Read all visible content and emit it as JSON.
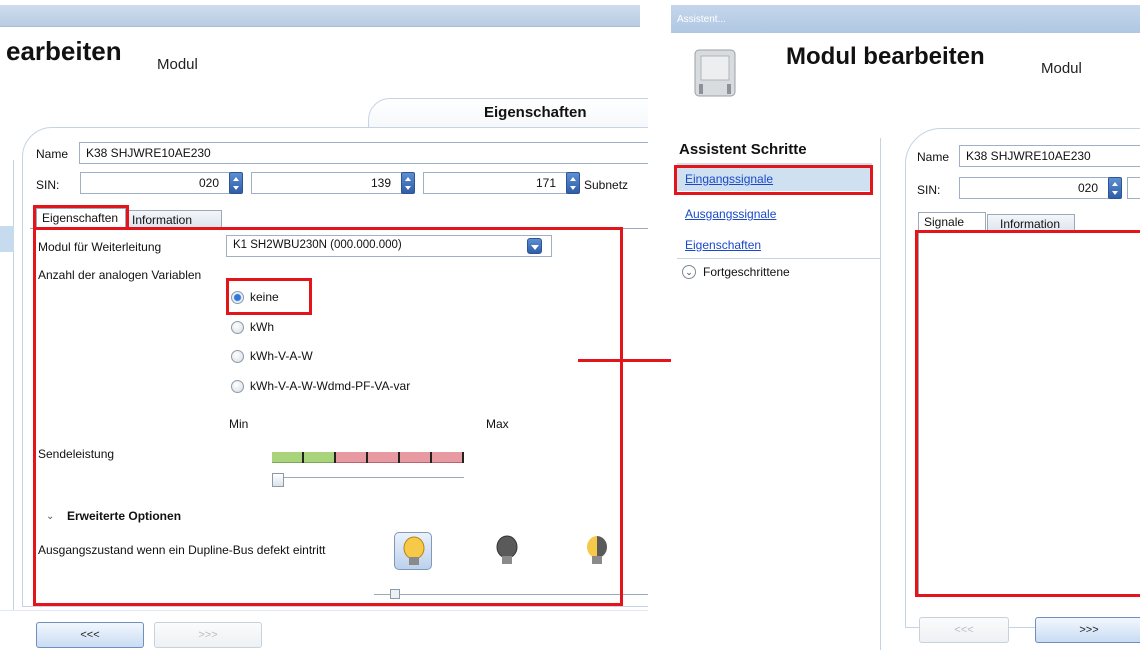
{
  "left": {
    "title": "earbeiten",
    "subtitle": "Modul",
    "tab_header": "Eigenschaften",
    "name_label": "Name",
    "name_value": "K38 SHJWRE10AE230",
    "sin_label": "SIN:",
    "sin_values": [
      "020",
      "139",
      "171"
    ],
    "subnetz_label": "Subnetz",
    "tabs": [
      "Eigenschaften",
      "Information"
    ],
    "modul_label": "Modul für Weiterleitung",
    "modul_value": "K1 SH2WBU230N (000.000.000)",
    "analog_label": "Anzahl der analogen Variablen",
    "radio_options": [
      "keine",
      "kWh",
      "kWh-V-A-W",
      "kWh-V-A-W-Wdmd-PF-VA-var"
    ],
    "min_label": "Min",
    "max_label": "Max",
    "sende_label": "Sendeleistung",
    "sende_level": 0,
    "erweiterte_label": "Erweiterte Optionen",
    "ausgang_label": "Ausgangszustand wenn ein Dupline-Bus defekt eintritt",
    "back_button": "<<<",
    "next_button": ">>>"
  },
  "right": {
    "window_title": "Assistent...",
    "title": "Modul bearbeiten",
    "subtitle": "Modul",
    "steps_header": "Assistent Schritte",
    "steps": [
      "Eingangssignale",
      "Ausgangssignale",
      "Eigenschaften"
    ],
    "advanced": "Fortgeschrittene",
    "name_label": "Name",
    "name_value": "K38 SHJWRE10AE230",
    "sin_label": "SIN:",
    "sin_value": "020",
    "tabs": [
      "Signale",
      "Information"
    ],
    "back_button": "<<<",
    "next_button": ">>>"
  },
  "colors": {
    "highlight_red": "#e3141a",
    "link_blue": "#1a49c8",
    "arrow_red": "#e3141a"
  }
}
